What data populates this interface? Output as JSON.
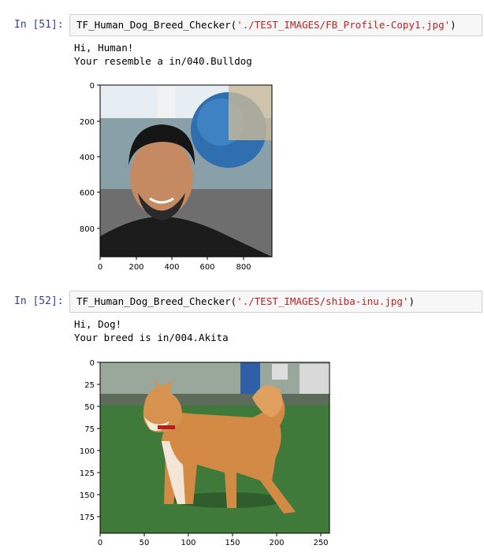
{
  "cells": [
    {
      "prompt": "In [51]:",
      "call_fn": "TF_Human_Dog_Breed_Checker(",
      "call_arg": "'./TEST_IMAGES/FB_Profile-Copy1.jpg'",
      "call_close": ")",
      "output_lines": [
        "Hi, Human!",
        "Your resemble a in/040.Bulldog"
      ],
      "image_icon": "human-selfie-photo",
      "x_ticks": [
        "0",
        "200",
        "400",
        "600",
        "800"
      ],
      "y_ticks": [
        "0",
        "200",
        "400",
        "600",
        "800"
      ]
    },
    {
      "prompt": "In [52]:",
      "call_fn": "TF_Human_Dog_Breed_Checker(",
      "call_arg": "'./TEST_IMAGES/shiba-inu.jpg'",
      "call_close": ")",
      "output_lines": [
        "Hi, Dog!",
        "Your breed is in/004.Akita"
      ],
      "image_icon": "shiba-inu-dog-photo",
      "x_ticks": [
        "0",
        "50",
        "100",
        "150",
        "200",
        "250"
      ],
      "y_ticks": [
        "0",
        "25",
        "50",
        "75",
        "100",
        "125",
        "150",
        "175"
      ]
    }
  ],
  "colors": {
    "prompt": "#303f9f",
    "string": "#ba2121",
    "input_bg": "#f7f7f7"
  }
}
